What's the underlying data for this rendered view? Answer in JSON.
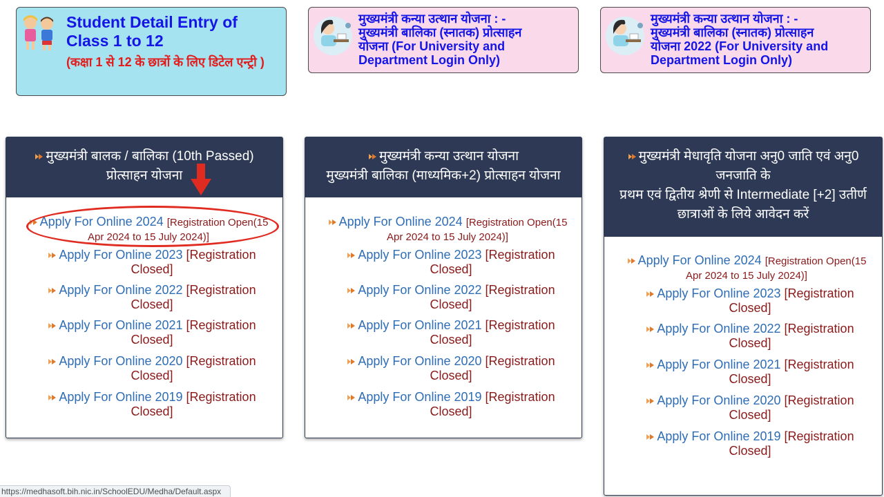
{
  "tiles": {
    "student": {
      "title": "Student Detail Entry of Class 1 to 12",
      "subtitle": "(कक्षा 1 से 12 के छात्रों के लिए डिटेल एन्ट्री )"
    },
    "kanya1": {
      "line1": "मुख्यमंत्री कन्या उत्थान योजना : -",
      "line2": "मुख्यमंत्री बालिका (स्नातक) प्रोत्साहन",
      "line3": "योजना (For University and",
      "line4": "Department Login Only)"
    },
    "kanya2": {
      "line1": "मुख्यमंत्री कन्या उत्थान योजना : -",
      "line2": "मुख्यमंत्री बालिका (स्नातक) प्रोत्साहन",
      "line3": "योजना 2022 (For University and",
      "line4": "Department Login Only)"
    }
  },
  "cards": {
    "card1": {
      "heading_line1": "मुख्यमंत्री बालक / बालिका (10th Passed)",
      "heading_line2": "प्रोत्साहन योजना",
      "items": [
        {
          "link": "Apply For Online 2024",
          "status": "[Registration Open(15 Apr 2024 to 15 July 2024)]"
        },
        {
          "link": "Apply For Online 2023",
          "status": "[Registration Closed]"
        },
        {
          "link": "Apply For Online 2022",
          "status": "[Registration Closed]"
        },
        {
          "link": "Apply For Online 2021",
          "status": "[Registration Closed]"
        },
        {
          "link": "Apply For Online 2020",
          "status": "[Registration Closed]"
        },
        {
          "link": "Apply For Online 2019",
          "status": "[Registration Closed]"
        }
      ]
    },
    "card2": {
      "heading_line1": "मुख्यमंत्री कन्या उत्थान योजना",
      "heading_line2": "मुख्यमंत्री बालिका (माध्यमिक+2) प्रोत्साहन योजना",
      "items": [
        {
          "link": "Apply For Online 2024",
          "status": "[Registration Open(15 Apr 2024 to 15 July 2024)]"
        },
        {
          "link": "Apply For Online 2023",
          "status": "[Registration Closed]"
        },
        {
          "link": "Apply For Online 2022",
          "status": "[Registration Closed]"
        },
        {
          "link": "Apply For Online 2021",
          "status": "[Registration Closed]"
        },
        {
          "link": "Apply For Online 2020",
          "status": "[Registration Closed]"
        },
        {
          "link": "Apply For Online 2019",
          "status": "[Registration Closed]"
        }
      ]
    },
    "card3": {
      "heading_line1": "मुख्यमंत्री मेधावृति योजना अनु0 जाति एवं अनु0",
      "heading_line2": "जनजाति के",
      "heading_line3": "प्रथम एवं द्वितीय श्रेणी से Intermediate [+2] उतीर्ण",
      "heading_line4": "छात्राओं के लिये आवेदन करें",
      "items": [
        {
          "link": "Apply For Online 2024",
          "status": "[Registration Open(15 Apr 2024 to 15 July 2024)]"
        },
        {
          "link": "Apply For Online 2023",
          "status": "[Registration Closed]"
        },
        {
          "link": "Apply For Online 2022",
          "status": "[Registration Closed]"
        },
        {
          "link": "Apply For Online 2021",
          "status": "[Registration Closed]"
        },
        {
          "link": "Apply For Online 2020",
          "status": "[Registration Closed]"
        },
        {
          "link": "Apply For Online 2019",
          "status": "[Registration Closed]"
        }
      ]
    }
  },
  "status_url": "https://medhasoft.bih.nic.in/SchoolEDU/Medha/Default.aspx",
  "colors": {
    "card_header": "#2e3a55",
    "link": "#2e6db5",
    "status": "#8a1a1a",
    "tile_blue": "#a4e3ef",
    "tile_pink": "#f9d9ea",
    "annotation_red": "#e02b20"
  }
}
